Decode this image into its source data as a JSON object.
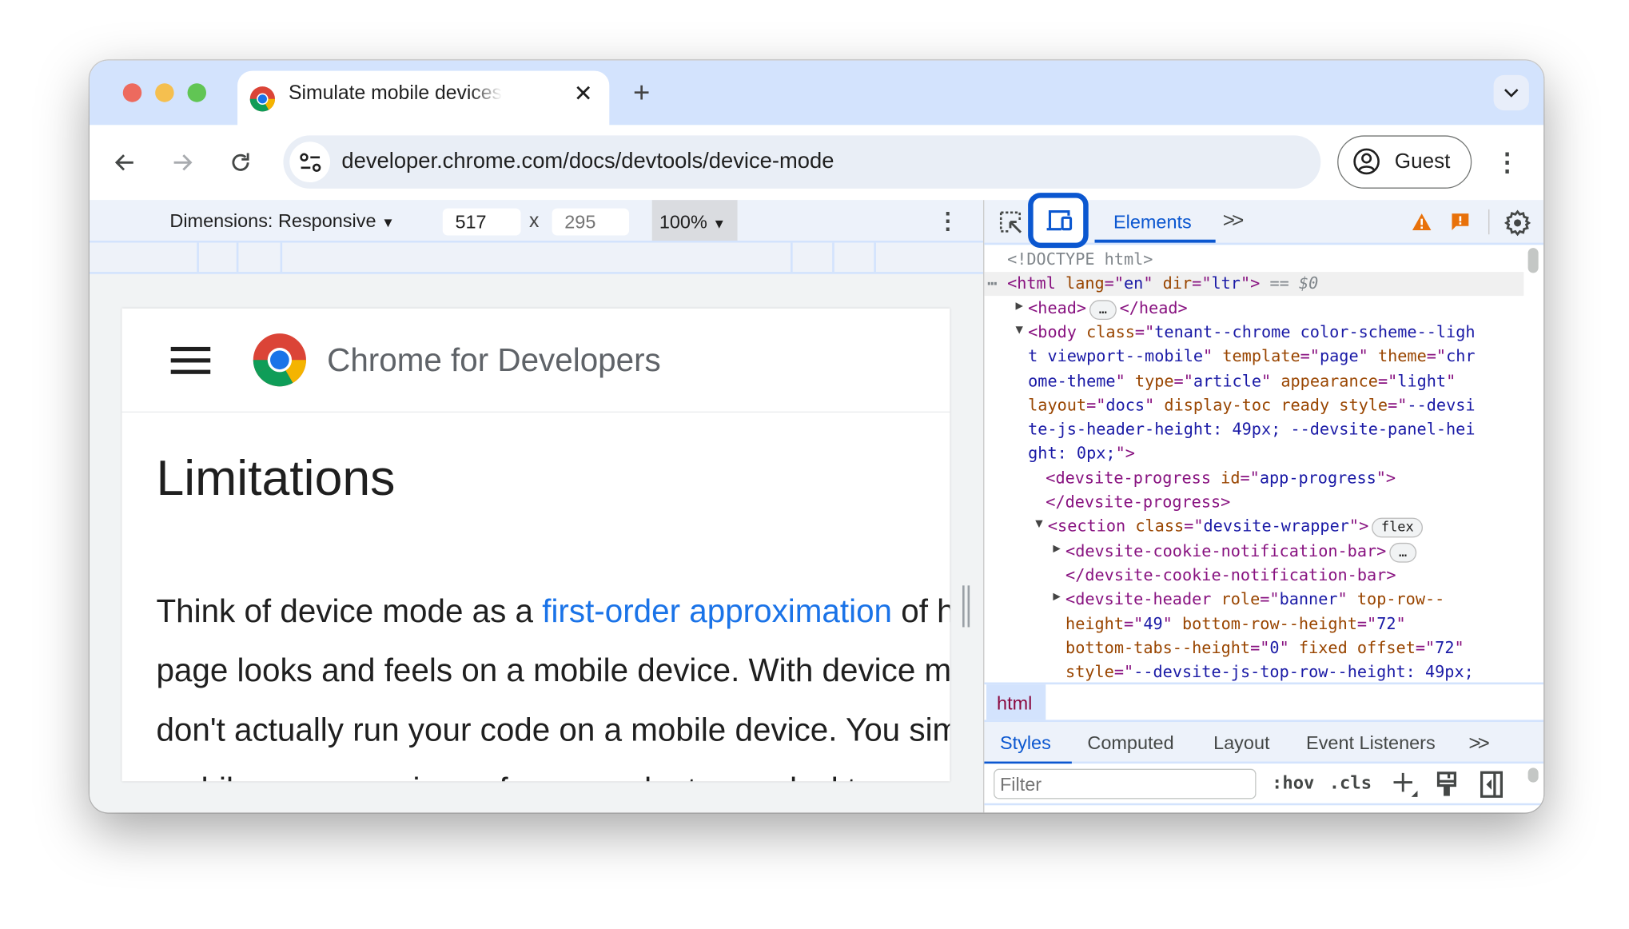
{
  "browser": {
    "tab_title": "Simulate mobile devices with Device Mode",
    "url": "developer.chrome.com/docs/devtools/device-mode",
    "profile_label": "Guest",
    "colors": {
      "tabbar": "#d3e3fd",
      "accent": "#0b57d0"
    }
  },
  "device_toolbar": {
    "dimensions_label": "Dimensions: Responsive",
    "width": "517",
    "times": "x",
    "height": "295",
    "zoom": "100%"
  },
  "page": {
    "site_title": "Chrome for Developers",
    "heading": "Limitations",
    "para_before_link": "Think of device mode as a ",
    "link_text": "first-order approximation",
    "para_after_link": " of how your",
    "line2": "page looks and feels on a mobile device. With device mode you",
    "line3": "don't actually run your code on a mobile device. You simulate the",
    "line4": "mobile user experience from your laptop or desktop."
  },
  "devtools": {
    "active_tab": "Elements",
    "more_tabs": ">>",
    "dom_lines": [
      {
        "tokens": [
          {
            "c": "gr",
            "v": "<!DOCTYPE html>"
          }
        ]
      },
      {
        "tokens": [
          {
            "c": "tag",
            "v": "<html "
          },
          {
            "c": "an",
            "v": "lang"
          },
          {
            "c": "tag",
            "v": "=\""
          },
          {
            "c": "av",
            "v": "en"
          },
          {
            "c": "tag",
            "v": "\" "
          },
          {
            "c": "an",
            "v": "dir"
          },
          {
            "c": "tag",
            "v": "=\""
          },
          {
            "c": "av",
            "v": "ltr"
          },
          {
            "c": "tag",
            "v": "\">"
          },
          {
            "c": "gr",
            "v": " == $0"
          }
        ]
      },
      {
        "arrow": "right",
        "tokens": [
          {
            "c": "tag",
            "v": "<head>"
          },
          {
            "c": "badge",
            "v": "…"
          },
          {
            "c": "tag",
            "v": "</head>"
          }
        ]
      },
      {
        "arrow": "down",
        "tokens": [
          {
            "c": "tag",
            "v": "<body "
          },
          {
            "c": "an",
            "v": "class"
          },
          {
            "c": "tag",
            "v": "=\""
          },
          {
            "c": "av",
            "v": "tenant--chrome color-scheme--ligh"
          }
        ]
      },
      {
        "tokens": [
          {
            "c": "av",
            "v": "t viewport--mobile"
          },
          {
            "c": "tag",
            "v": "\" "
          },
          {
            "c": "an",
            "v": "template"
          },
          {
            "c": "tag",
            "v": "=\""
          },
          {
            "c": "av",
            "v": "page"
          },
          {
            "c": "tag",
            "v": "\" "
          },
          {
            "c": "an",
            "v": "theme"
          },
          {
            "c": "tag",
            "v": "=\""
          },
          {
            "c": "av",
            "v": "chr"
          }
        ]
      },
      {
        "tokens": [
          {
            "c": "av",
            "v": "ome-theme"
          },
          {
            "c": "tag",
            "v": "\" "
          },
          {
            "c": "an",
            "v": "type"
          },
          {
            "c": "tag",
            "v": "=\""
          },
          {
            "c": "av",
            "v": "article"
          },
          {
            "c": "tag",
            "v": "\" "
          },
          {
            "c": "an",
            "v": "appearance"
          },
          {
            "c": "tag",
            "v": "=\""
          },
          {
            "c": "av",
            "v": "light"
          },
          {
            "c": "tag",
            "v": "\""
          }
        ]
      },
      {
        "tokens": [
          {
            "c": "an",
            "v": "layout"
          },
          {
            "c": "tag",
            "v": "=\""
          },
          {
            "c": "av",
            "v": "docs"
          },
          {
            "c": "tag",
            "v": "\" "
          },
          {
            "c": "an",
            "v": "display-toc ready style"
          },
          {
            "c": "tag",
            "v": "=\""
          },
          {
            "c": "av",
            "v": "--devsi"
          }
        ]
      },
      {
        "tokens": [
          {
            "c": "av",
            "v": "te-js-header-height: 49px; --devsite-panel-hei"
          }
        ]
      },
      {
        "tokens": [
          {
            "c": "av",
            "v": "ght: 0px;"
          },
          {
            "c": "tag",
            "v": "\">"
          }
        ]
      },
      {
        "tokens": [
          {
            "c": "tag",
            "v": "<devsite-progress "
          },
          {
            "c": "an",
            "v": "id"
          },
          {
            "c": "tag",
            "v": "=\""
          },
          {
            "c": "av",
            "v": "app-progress"
          },
          {
            "c": "tag",
            "v": "\">"
          }
        ]
      },
      {
        "tokens": [
          {
            "c": "tag",
            "v": "</devsite-progress>"
          }
        ]
      },
      {
        "arrow": "down",
        "tokens": [
          {
            "c": "tag",
            "v": "<section "
          },
          {
            "c": "an",
            "v": "class"
          },
          {
            "c": "tag",
            "v": "=\""
          },
          {
            "c": "av",
            "v": "devsite-wrapper"
          },
          {
            "c": "tag",
            "v": "\">"
          },
          {
            "c": "badge",
            "v": "flex"
          }
        ]
      },
      {
        "arrow": "right",
        "tokens": [
          {
            "c": "tag",
            "v": "<devsite-cookie-notification-bar>"
          },
          {
            "c": "badge",
            "v": "…"
          }
        ]
      },
      {
        "tokens": [
          {
            "c": "tag",
            "v": "</devsite-cookie-notification-bar>"
          }
        ]
      },
      {
        "arrow": "right",
        "tokens": [
          {
            "c": "tag",
            "v": "<devsite-header "
          },
          {
            "c": "an",
            "v": "role"
          },
          {
            "c": "tag",
            "v": "=\""
          },
          {
            "c": "av",
            "v": "banner"
          },
          {
            "c": "tag",
            "v": "\" "
          },
          {
            "c": "an",
            "v": "top-row--"
          }
        ]
      },
      {
        "tokens": [
          {
            "c": "an",
            "v": "height"
          },
          {
            "c": "tag",
            "v": "=\""
          },
          {
            "c": "av",
            "v": "49"
          },
          {
            "c": "tag",
            "v": "\" "
          },
          {
            "c": "an",
            "v": "bottom-row--height"
          },
          {
            "c": "tag",
            "v": "=\""
          },
          {
            "c": "av",
            "v": "72"
          },
          {
            "c": "tag",
            "v": "\""
          }
        ]
      },
      {
        "tokens": [
          {
            "c": "an",
            "v": "bottom-tabs--height"
          },
          {
            "c": "tag",
            "v": "=\""
          },
          {
            "c": "av",
            "v": "0"
          },
          {
            "c": "tag",
            "v": "\" "
          },
          {
            "c": "an",
            "v": "fixed offset"
          },
          {
            "c": "tag",
            "v": "=\""
          },
          {
            "c": "av",
            "v": "72"
          },
          {
            "c": "tag",
            "v": "\""
          }
        ]
      },
      {
        "tokens": [
          {
            "c": "an",
            "v": "style"
          },
          {
            "c": "tag",
            "v": "=\""
          },
          {
            "c": "av",
            "v": "--devsite-js-top-row--height: 49px;"
          }
        ]
      }
    ],
    "breadcrumb": "html",
    "styles_tabs": [
      "Styles",
      "Computed",
      "Layout",
      "Event Listeners"
    ],
    "styles_more": ">>",
    "filter_placeholder": "Filter",
    "hov": ":hov",
    "cls": ".cls"
  }
}
